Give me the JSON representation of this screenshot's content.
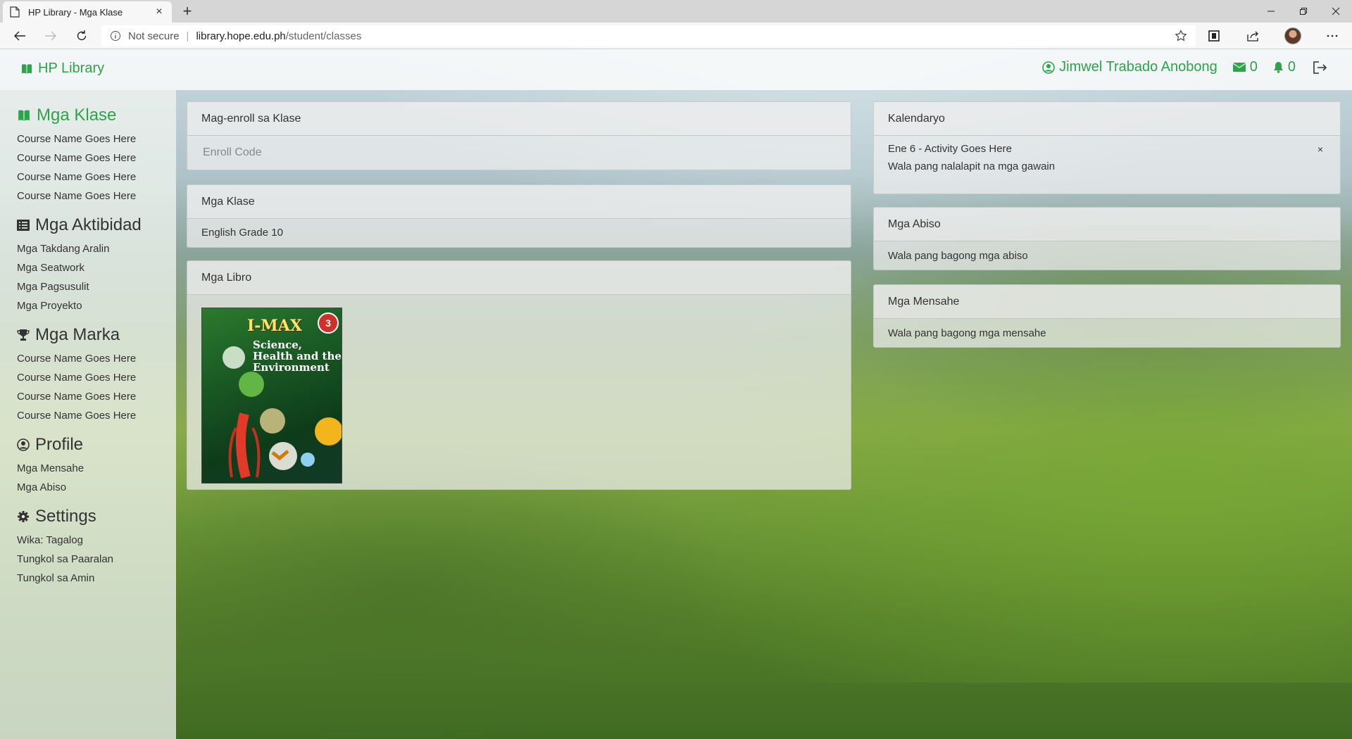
{
  "browser": {
    "tab_title": "HP Library - Mga Klase",
    "tab_close": "×",
    "new_tab": "+",
    "security_label": "Not secure",
    "url_separator": "|",
    "url_host": "library.hope.edu.ph",
    "url_path": "/student/classes"
  },
  "navbar": {
    "brand": "HP Library",
    "user_name": "Jimwel Trabado Anobong",
    "messages_count": "0",
    "notifications_count": "0"
  },
  "sidebar": {
    "classes": {
      "title": "Mga Klase",
      "items": [
        "Course Name Goes Here",
        "Course Name Goes Here",
        "Course Name Goes Here",
        "Course Name Goes Here"
      ]
    },
    "activities": {
      "title": "Mga Aktibidad",
      "items": [
        "Mga Takdang Aralin",
        "Mga Seatwork",
        "Mga Pagsusulit",
        "Mga Proyekto"
      ]
    },
    "grades": {
      "title": "Mga Marka",
      "items": [
        "Course Name Goes Here",
        "Course Name Goes Here",
        "Course Name Goes Here",
        "Course Name Goes Here"
      ]
    },
    "profile": {
      "title": "Profile",
      "items": [
        "Mga Mensahe",
        "Mga Abiso"
      ]
    },
    "settings": {
      "title": "Settings",
      "items": [
        "Wika: Tagalog",
        "Tungkol sa Paaralan",
        "Tungkol sa Amin"
      ]
    }
  },
  "enroll": {
    "title": "Mag-enroll sa Klase",
    "placeholder": "Enroll Code"
  },
  "classes_card": {
    "title": "Mga Klase",
    "items": [
      "English Grade 10"
    ]
  },
  "books_card": {
    "title": "Mga Libro",
    "book": {
      "title": "I-MAX",
      "subtitle": "Science, Health and the Environment",
      "badge": "3"
    }
  },
  "calendar": {
    "title": "Kalendaryo",
    "activity": "Ene 6 - Activity Goes Here",
    "close": "×",
    "empty": "Wala pang nalalapit na mga gawain"
  },
  "notices": {
    "title": "Mga Abiso",
    "empty": "Wala pang bagong mga abiso"
  },
  "messages": {
    "title": "Mga Mensahe",
    "empty": "Wala pang bagong mga mensahe"
  },
  "colors": {
    "accent": "#2ea34a"
  },
  "icons": [
    "page-icon",
    "back-icon",
    "forward-icon",
    "refresh-icon",
    "info-icon",
    "star-icon",
    "reading-list-icon",
    "share-icon",
    "more-icon",
    "book-icon",
    "user-circle-icon",
    "envelope-icon",
    "bell-icon",
    "logout-icon",
    "list-icon",
    "trophy-icon",
    "gear-icon"
  ]
}
